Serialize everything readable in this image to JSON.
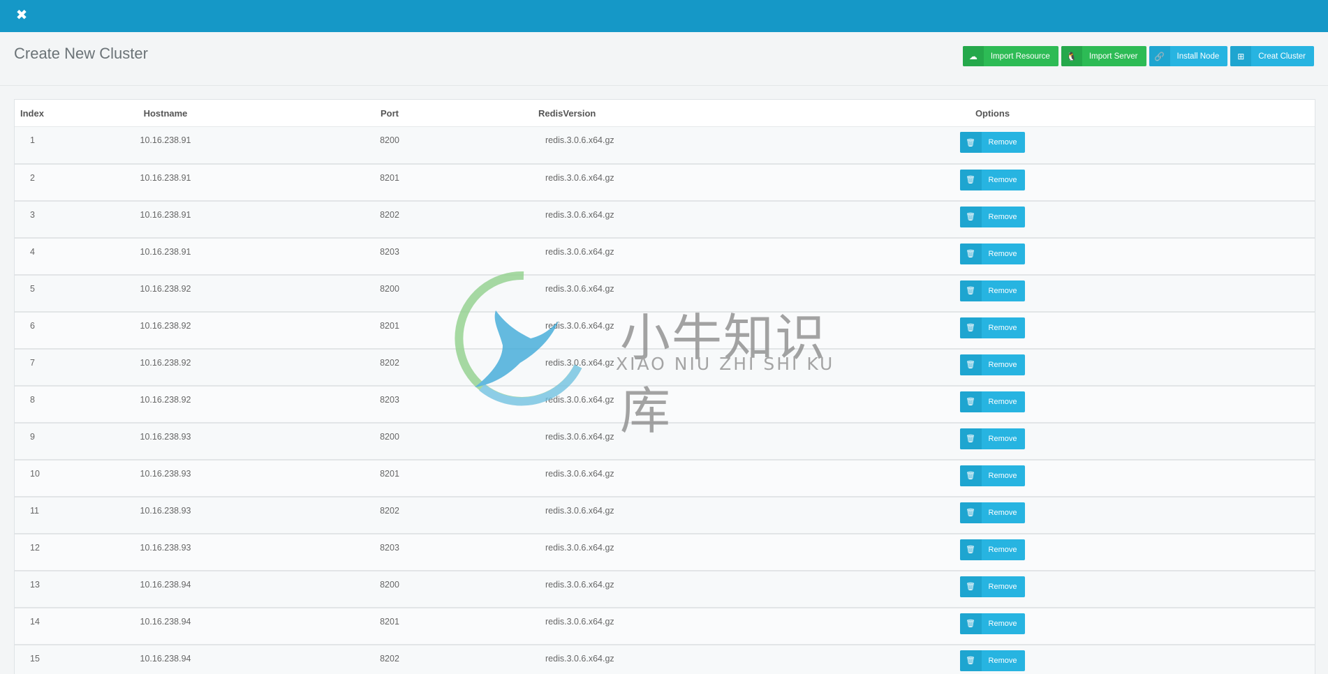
{
  "app": {
    "logo_icon": "joomla-like-x-logo"
  },
  "header": {
    "title": "Create New Cluster"
  },
  "actions": [
    {
      "label": "Import Resource",
      "icon": "cloud-upload-icon",
      "color": "#2dbb55"
    },
    {
      "label": "Import Server",
      "icon": "linux-icon",
      "color": "#2dbb55"
    },
    {
      "label": "Install Node",
      "icon": "link-icon",
      "color": "#27b4e1"
    },
    {
      "label": "Creat Cluster",
      "icon": "sitemap-icon",
      "color": "#27b4e1"
    }
  ],
  "table": {
    "headers": {
      "index": "Index",
      "hostname": "Hostname",
      "port": "Port",
      "version": "RedisVersion",
      "options": "Options"
    },
    "remove_label": "Remove",
    "rows": [
      {
        "index": "1",
        "hostname": "10.16.238.91",
        "port": "8200",
        "version": "redis.3.0.6.x64.gz"
      },
      {
        "index": "2",
        "hostname": "10.16.238.91",
        "port": "8201",
        "version": "redis.3.0.6.x64.gz"
      },
      {
        "index": "3",
        "hostname": "10.16.238.91",
        "port": "8202",
        "version": "redis.3.0.6.x64.gz"
      },
      {
        "index": "4",
        "hostname": "10.16.238.91",
        "port": "8203",
        "version": "redis.3.0.6.x64.gz"
      },
      {
        "index": "5",
        "hostname": "10.16.238.92",
        "port": "8200",
        "version": "redis.3.0.6.x64.gz"
      },
      {
        "index": "6",
        "hostname": "10.16.238.92",
        "port": "8201",
        "version": "redis.3.0.6.x64.gz"
      },
      {
        "index": "7",
        "hostname": "10.16.238.92",
        "port": "8202",
        "version": "redis.3.0.6.x64.gz"
      },
      {
        "index": "8",
        "hostname": "10.16.238.92",
        "port": "8203",
        "version": "redis.3.0.6.x64.gz"
      },
      {
        "index": "9",
        "hostname": "10.16.238.93",
        "port": "8200",
        "version": "redis.3.0.6.x64.gz"
      },
      {
        "index": "10",
        "hostname": "10.16.238.93",
        "port": "8201",
        "version": "redis.3.0.6.x64.gz"
      },
      {
        "index": "11",
        "hostname": "10.16.238.93",
        "port": "8202",
        "version": "redis.3.0.6.x64.gz"
      },
      {
        "index": "12",
        "hostname": "10.16.238.93",
        "port": "8203",
        "version": "redis.3.0.6.x64.gz"
      },
      {
        "index": "13",
        "hostname": "10.16.238.94",
        "port": "8200",
        "version": "redis.3.0.6.x64.gz"
      },
      {
        "index": "14",
        "hostname": "10.16.238.94",
        "port": "8201",
        "version": "redis.3.0.6.x64.gz"
      },
      {
        "index": "15",
        "hostname": "10.16.238.94",
        "port": "8202",
        "version": "redis.3.0.6.x64.gz"
      }
    ]
  },
  "watermark": {
    "cn": "小牛知识库",
    "en": "XIAO NIU ZHI SHI KU"
  }
}
